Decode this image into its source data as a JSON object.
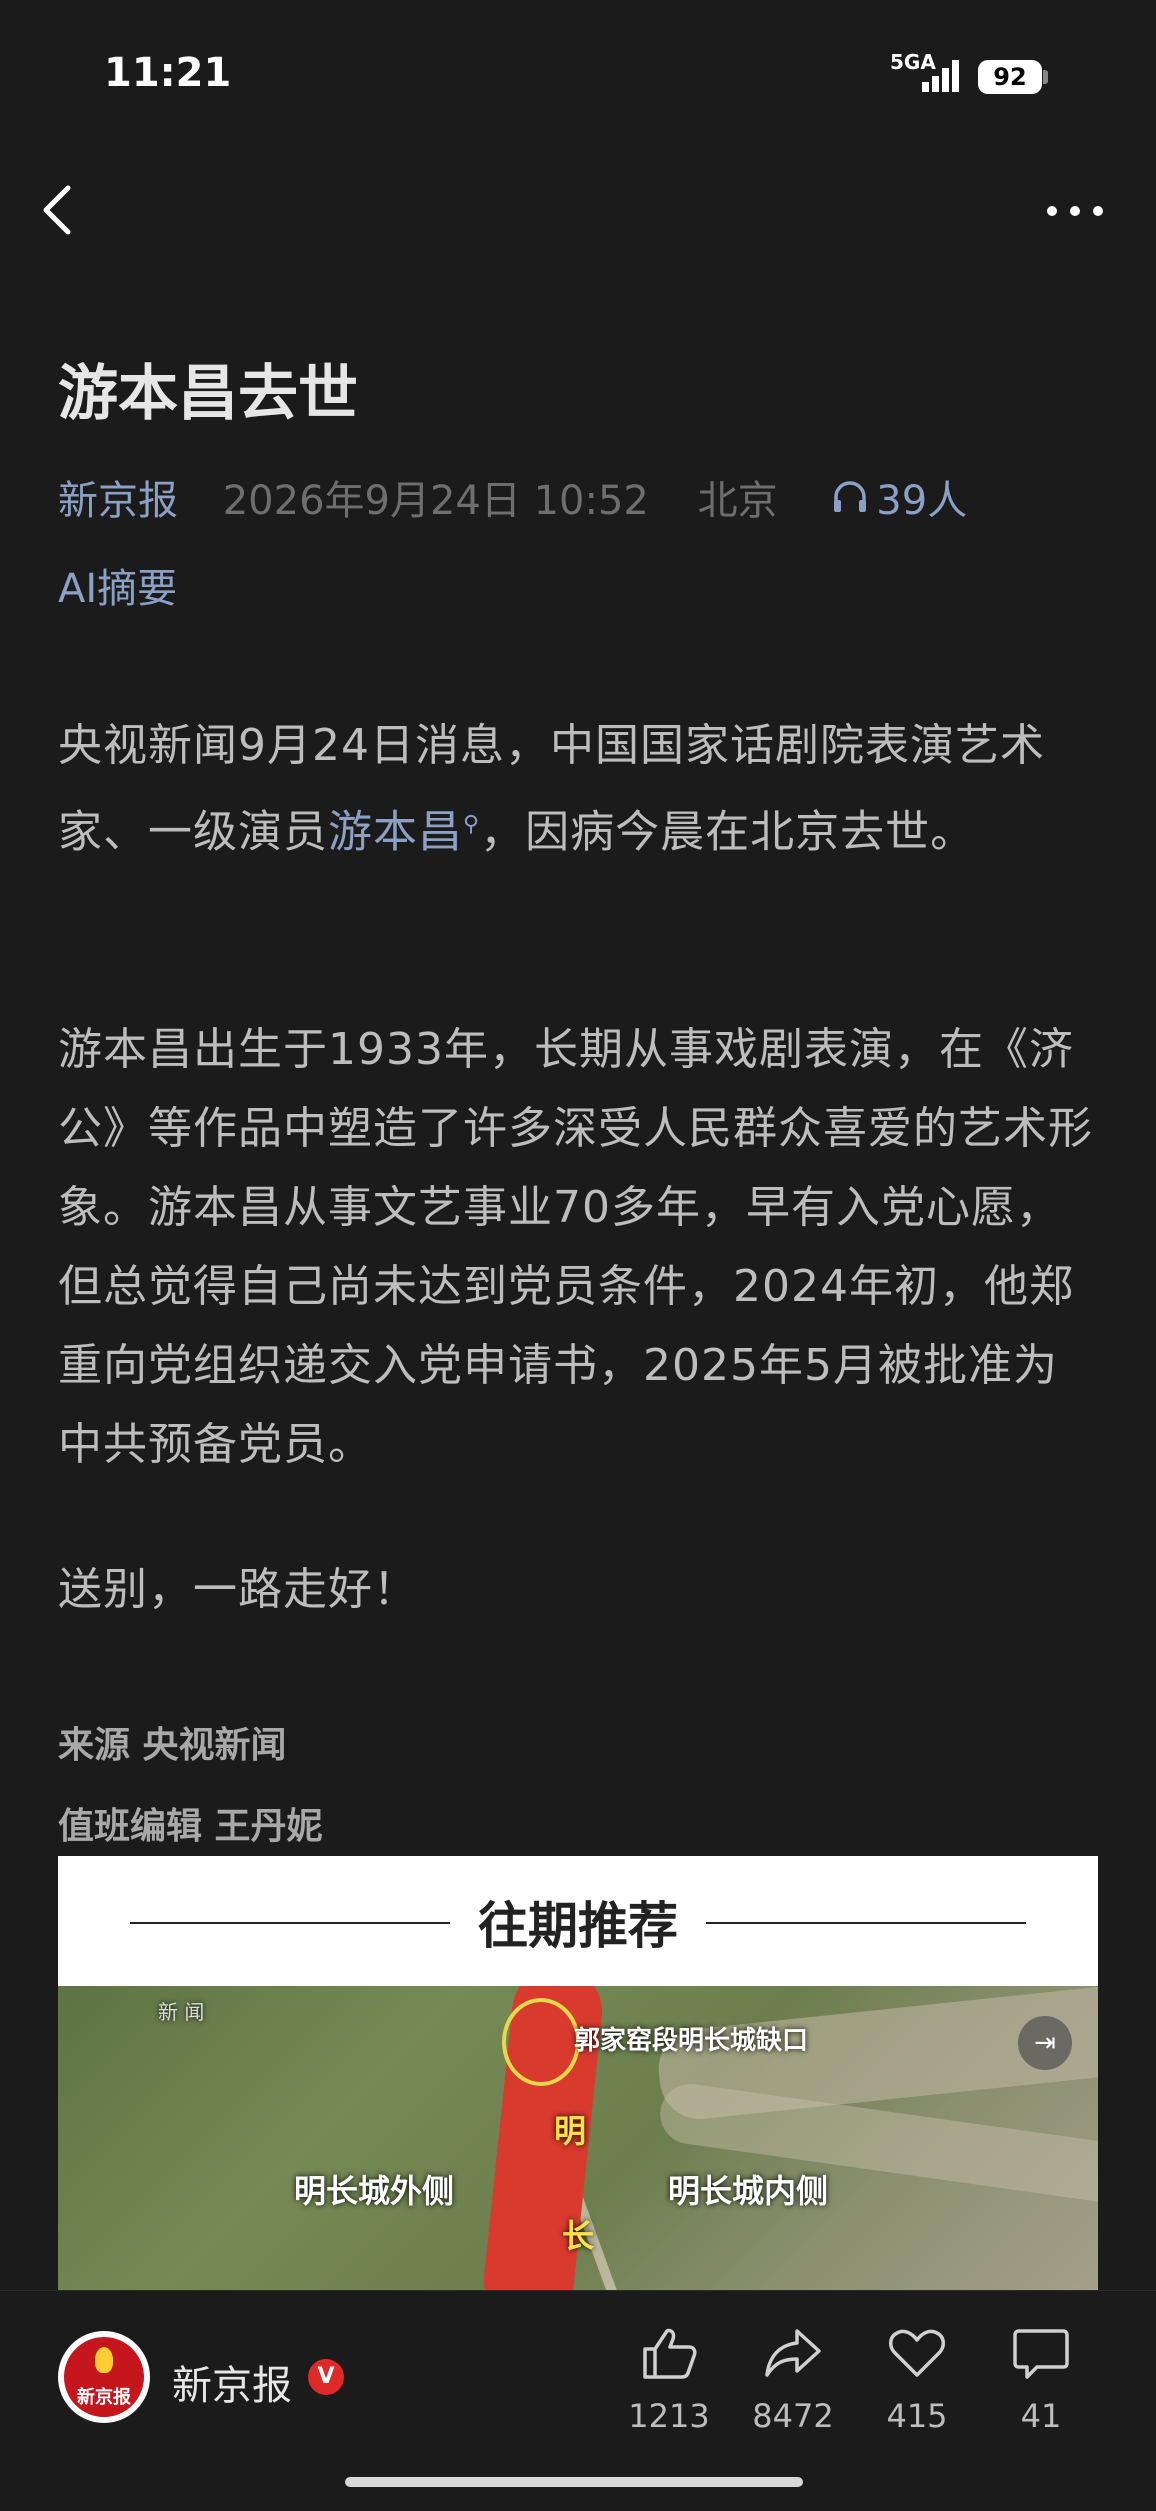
{
  "status": {
    "time": "11:21",
    "network": "5GA",
    "battery": "92"
  },
  "article": {
    "title": "游本昌去世",
    "source": "新京报",
    "date": "2026年9月24日 10:52",
    "location": "北京",
    "listeners": "39人",
    "ai_summary": "AI摘要",
    "p1_before": "央视新闻9月24日消息，中国国家话剧院表演艺术家、一级演员",
    "p1_link": "游本昌",
    "p1_after": "，因病今晨在北京去世。",
    "p2": "游本昌出生于1933年，长期从事戏剧表演，在《济公》等作品中塑造了许多深受人民群众喜爱的艺术形象。游本昌从事文艺事业70多年，早有入党心愿，但总觉得自己尚未达到党员条件，2024年初，他郑重向党组织递交入党申请书，2025年5月被批准为中共预备党员。",
    "p3": "送别，一路走好！",
    "credit_source": "来源 央视新闻",
    "credit_editor": "值班编辑 王丹妮"
  },
  "promo": {
    "title": "往期推荐",
    "label_news": "新 闻",
    "label_gap": "郭家窑段明长城缺口",
    "label_outside": "明长城外侧",
    "label_inside": "明长城内侧",
    "label_ming": "明",
    "label_chang": "长"
  },
  "bottom": {
    "logo_text": "新京报",
    "channel": "新京报",
    "verified": "V",
    "likes": "1213",
    "shares": "8472",
    "favorites": "415",
    "comments": "41"
  },
  "icons": [
    "back-icon",
    "more-icon",
    "headphones-icon",
    "search-icon",
    "like-icon",
    "share-icon",
    "heart-icon",
    "comment-icon",
    "exit-icon"
  ]
}
